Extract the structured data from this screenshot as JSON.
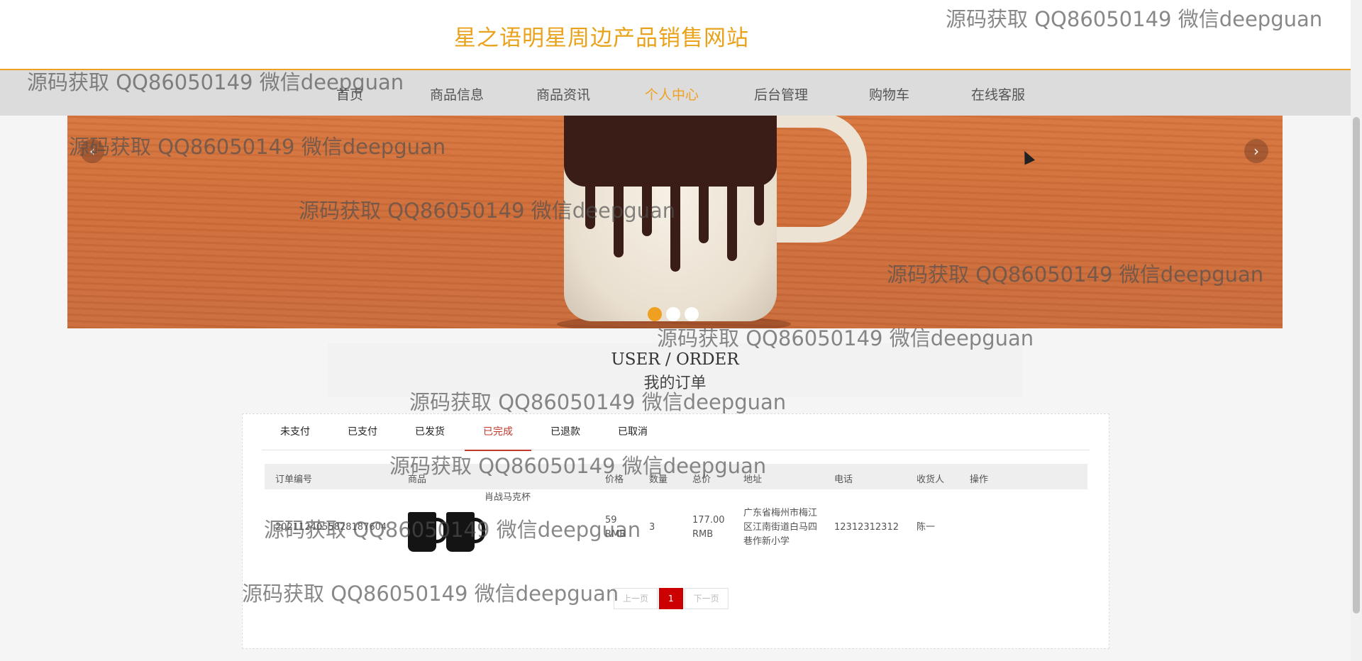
{
  "site": {
    "title": "星之语明星周边产品销售网站"
  },
  "nav": [
    {
      "label": "首页"
    },
    {
      "label": "商品信息"
    },
    {
      "label": "商品资讯"
    },
    {
      "label": "个人中心",
      "active": true
    },
    {
      "label": "后台管理"
    },
    {
      "label": "购物车"
    },
    {
      "label": "在线客服"
    }
  ],
  "banner": {
    "prev_icon": "‹",
    "next_icon": "›",
    "slide_count": 3,
    "active_slide": 1
  },
  "heading": {
    "en": "USER / ORDER",
    "cn": "我的订单"
  },
  "tabs": [
    {
      "label": "未支付"
    },
    {
      "label": "已支付"
    },
    {
      "label": "已发货"
    },
    {
      "label": "已完成",
      "active": true
    },
    {
      "label": "已退款"
    },
    {
      "label": "已取消"
    }
  ],
  "table": {
    "headers": [
      "订单编号",
      "商品",
      "价格",
      "数量",
      "总价",
      "地址",
      "电话",
      "收货人",
      "操作"
    ],
    "rows": [
      {
        "order_no": "2021124055828187604",
        "product_name": "肖战马克杯",
        "price": "59",
        "price_unit": "RMB",
        "quantity": "3",
        "total": "177.00",
        "total_unit": "RMB",
        "address": "广东省梅州市梅江区江南街道白马四巷作新小学",
        "phone": "12312312312",
        "receiver": "陈一",
        "action": ""
      }
    ]
  },
  "pager": {
    "prev": "上一页",
    "current": "1",
    "next": "下一页"
  },
  "watermark": "源码获取 QQ86050149 微信deepguan",
  "colors": {
    "accent": "#f0a020",
    "tab_active": "#c0392b",
    "page_active": "#cc0000"
  }
}
